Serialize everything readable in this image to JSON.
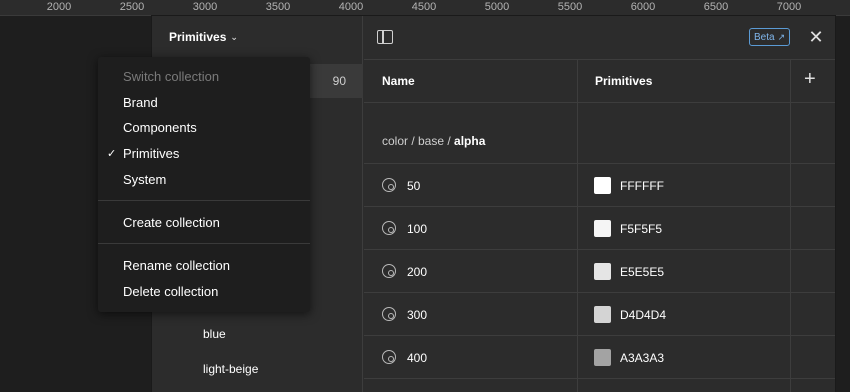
{
  "ruler": {
    "ticks": [
      "2000",
      "2500",
      "3000",
      "3500",
      "4000",
      "4500",
      "5000",
      "5500",
      "6000",
      "6500",
      "7000"
    ]
  },
  "collection": {
    "title": "Primitives",
    "selected_count": "90",
    "groups": [
      "blue",
      "light-beige"
    ]
  },
  "dropdown": {
    "header": "Switch collection",
    "collections": [
      "Brand",
      "Components",
      "Primitives",
      "System"
    ],
    "checked": "Primitives",
    "create": "Create collection",
    "rename": "Rename collection",
    "delete": "Delete collection"
  },
  "topbar": {
    "beta_label": "Beta",
    "close": "✕"
  },
  "table": {
    "col_name": "Name",
    "col_mode": "Primitives",
    "add": "+",
    "group_path_prefix": "color / base / ",
    "group_path_current": "alpha",
    "rows": [
      {
        "name": "50",
        "value": "FFFFFF",
        "swatch": "#FFFFFF"
      },
      {
        "name": "100",
        "value": "F5F5F5",
        "swatch": "#F5F5F5"
      },
      {
        "name": "200",
        "value": "E5E5E5",
        "swatch": "#E5E5E5"
      },
      {
        "name": "300",
        "value": "D4D4D4",
        "swatch": "#D4D4D4"
      },
      {
        "name": "400",
        "value": "A3A3A3",
        "swatch": "#A3A3A3"
      }
    ]
  },
  "colors": {
    "beta_accent": "#7fb5ea"
  }
}
